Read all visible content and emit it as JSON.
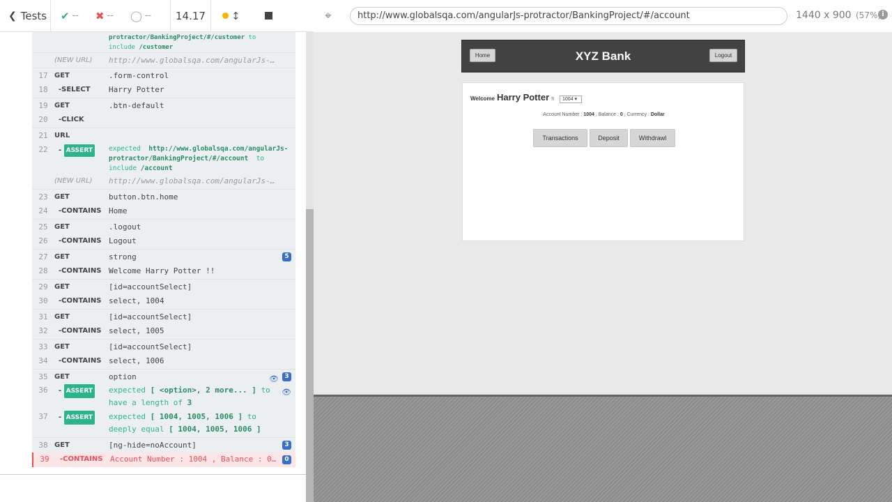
{
  "reporter": {
    "tests_label": "Tests",
    "passed": "--",
    "failed": "--",
    "pending": "--",
    "duration": "14.17"
  },
  "commands": [
    {
      "kind": "cont",
      "msg_parts": [
        "protractor/BankingProject/#/customer",
        "to",
        "include",
        "/customer"
      ]
    },
    {
      "kind": "newurl",
      "label": "(NEW URL)",
      "msg": "http://www.globalsqa.com/angularJs-pro..."
    },
    {
      "num": "17",
      "name": "GET",
      "msg": ".form-control"
    },
    {
      "num": "18",
      "name": "-SELECT",
      "msg": "Harry Potter"
    },
    {
      "num": "19",
      "name": "GET",
      "msg": ".btn-default"
    },
    {
      "num": "20",
      "name": "-CLICK",
      "msg": ""
    },
    {
      "num": "21",
      "name": "URL",
      "msg": ""
    },
    {
      "num": "22",
      "name": "ASSERT",
      "msg_a": "expected",
      "msg_b": "http://www.globalsqa.com/angularJs-protractor/BankingProject/#/account",
      "msg_c": "to include",
      "msg_d": "/account"
    },
    {
      "kind": "newurl",
      "label": "(NEW URL)",
      "msg": "http://www.globalsqa.com/angularJs-pro..."
    },
    {
      "num": "23",
      "name": "GET",
      "msg": "button.btn.home"
    },
    {
      "num": "24",
      "name": "-CONTAINS",
      "msg": "Home"
    },
    {
      "num": "25",
      "name": "GET",
      "msg": ".logout"
    },
    {
      "num": "26",
      "name": "-CONTAINS",
      "msg": "Logout"
    },
    {
      "num": "27",
      "name": "GET",
      "msg": "strong",
      "count": "5"
    },
    {
      "num": "28",
      "name": "-CONTAINS",
      "msg": "Welcome Harry Potter !!"
    },
    {
      "num": "29",
      "name": "GET",
      "msg": "[id=accountSelect]"
    },
    {
      "num": "30",
      "name": "-CONTAINS",
      "msg": "select, 1004"
    },
    {
      "num": "31",
      "name": "GET",
      "msg": "[id=accountSelect]"
    },
    {
      "num": "32",
      "name": "-CONTAINS",
      "msg": "select, 1005"
    },
    {
      "num": "33",
      "name": "GET",
      "msg": "[id=accountSelect]"
    },
    {
      "num": "34",
      "name": "-CONTAINS",
      "msg": "select, 1006"
    },
    {
      "num": "35",
      "name": "GET",
      "msg": "option",
      "count": "3"
    },
    {
      "num": "36",
      "name": "ASSERT",
      "msg_a": "expected",
      "msg_b": "[ <option>, 2 more... ]",
      "msg_c": "to",
      "msg_d": "have a length of",
      "msg_e": "3"
    },
    {
      "num": "37",
      "name": "ASSERT",
      "msg_a": "expected",
      "msg_b": "[ 1004, 1005, 1006 ]",
      "msg_c": "to",
      "msg_d": "deeply equal",
      "msg_e": "[ 1004, 1005, 1006 ]"
    },
    {
      "num": "38",
      "name": "GET",
      "msg": "[ng-hide=noAccount]",
      "count": "3"
    },
    {
      "num": "39",
      "name": "-CONTAINS",
      "msg": "Account Number : 1004 , Balance : 0 ...",
      "count": "0"
    }
  ],
  "aut": {
    "url": "http://www.globalsqa.com/angularJs-protractor/BankingProject/#/account",
    "viewport": "1440 x 900",
    "scale": "(57%)",
    "info_icon": "i"
  },
  "bank": {
    "home": "Home",
    "title": "XYZ Bank",
    "logout": "Logout",
    "welcome_label": "Welcome",
    "customer_name": "Harry Potter",
    "bang": "!!",
    "selected_account": "1004",
    "acct_number_label": "Account Number :",
    "acct_number": "1004",
    "balance_label": ", Balance :",
    "balance": "0",
    "currency_label": ", Currency :",
    "currency": "Dollar",
    "transactions": "Transactions",
    "deposit": "Deposit",
    "withdrawl": "Withdrawl"
  }
}
